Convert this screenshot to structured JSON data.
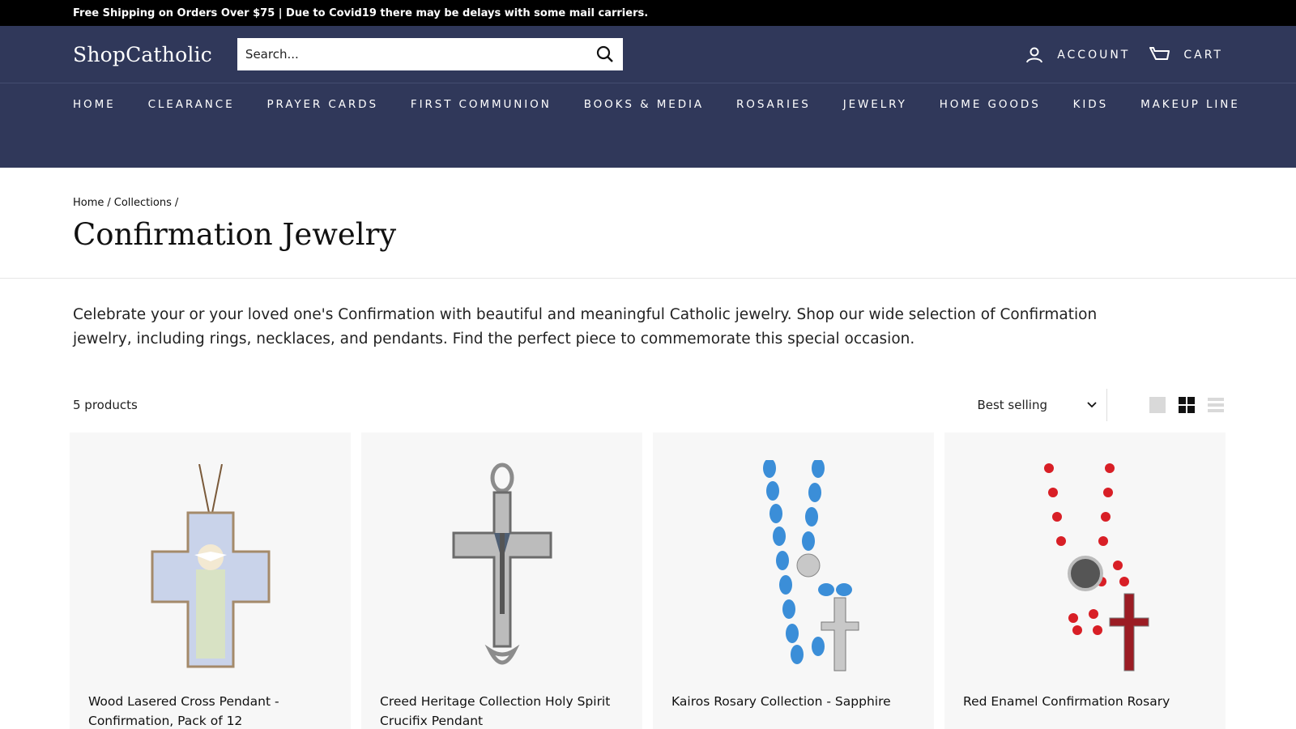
{
  "announcement": "Free Shipping on Orders Over $75 | Due to Covid19 there may be delays with some mail carriers.",
  "header": {
    "logo": "ShopCatholic",
    "search_placeholder": "Search...",
    "account_label": "ACCOUNT",
    "cart_label": "CART"
  },
  "nav": [
    "HOME",
    "CLEARANCE",
    "PRAYER CARDS",
    "FIRST COMMUNION",
    "BOOKS & MEDIA",
    "ROSARIES",
    "JEWELRY",
    "HOME GOODS",
    "KIDS",
    "MAKEUP LINE"
  ],
  "breadcrumb": {
    "home": "Home",
    "collections": "Collections",
    "sep": "/"
  },
  "page_title": "Confirmation Jewelry",
  "description": "Celebrate your or your loved one's Confirmation with beautiful and meaningful Catholic jewelry. Shop our wide selection of Confirmation jewelry, including rings, necklaces, and pendants. Find the perfect piece to commemorate this special occasion.",
  "toolbar": {
    "count": "5 products",
    "sort_selected": "Best selling"
  },
  "products": [
    {
      "name": "Wood Lasered Cross Pendant - Confirmation, Pack of 12"
    },
    {
      "name": "Creed Heritage Collection Holy Spirit Crucifix Pendant"
    },
    {
      "name": "Kairos Rosary Collection - Sapphire"
    },
    {
      "name": "Red Enamel Confirmation Rosary"
    }
  ],
  "colors": {
    "header_bg": "#30385a",
    "announce_bg": "#000000",
    "card_bg": "#f7f7f7"
  },
  "icons": [
    "search-icon",
    "account-icon",
    "cart-icon",
    "chevron-down-icon",
    "view-large-icon",
    "view-small-icon",
    "view-list-icon"
  ]
}
